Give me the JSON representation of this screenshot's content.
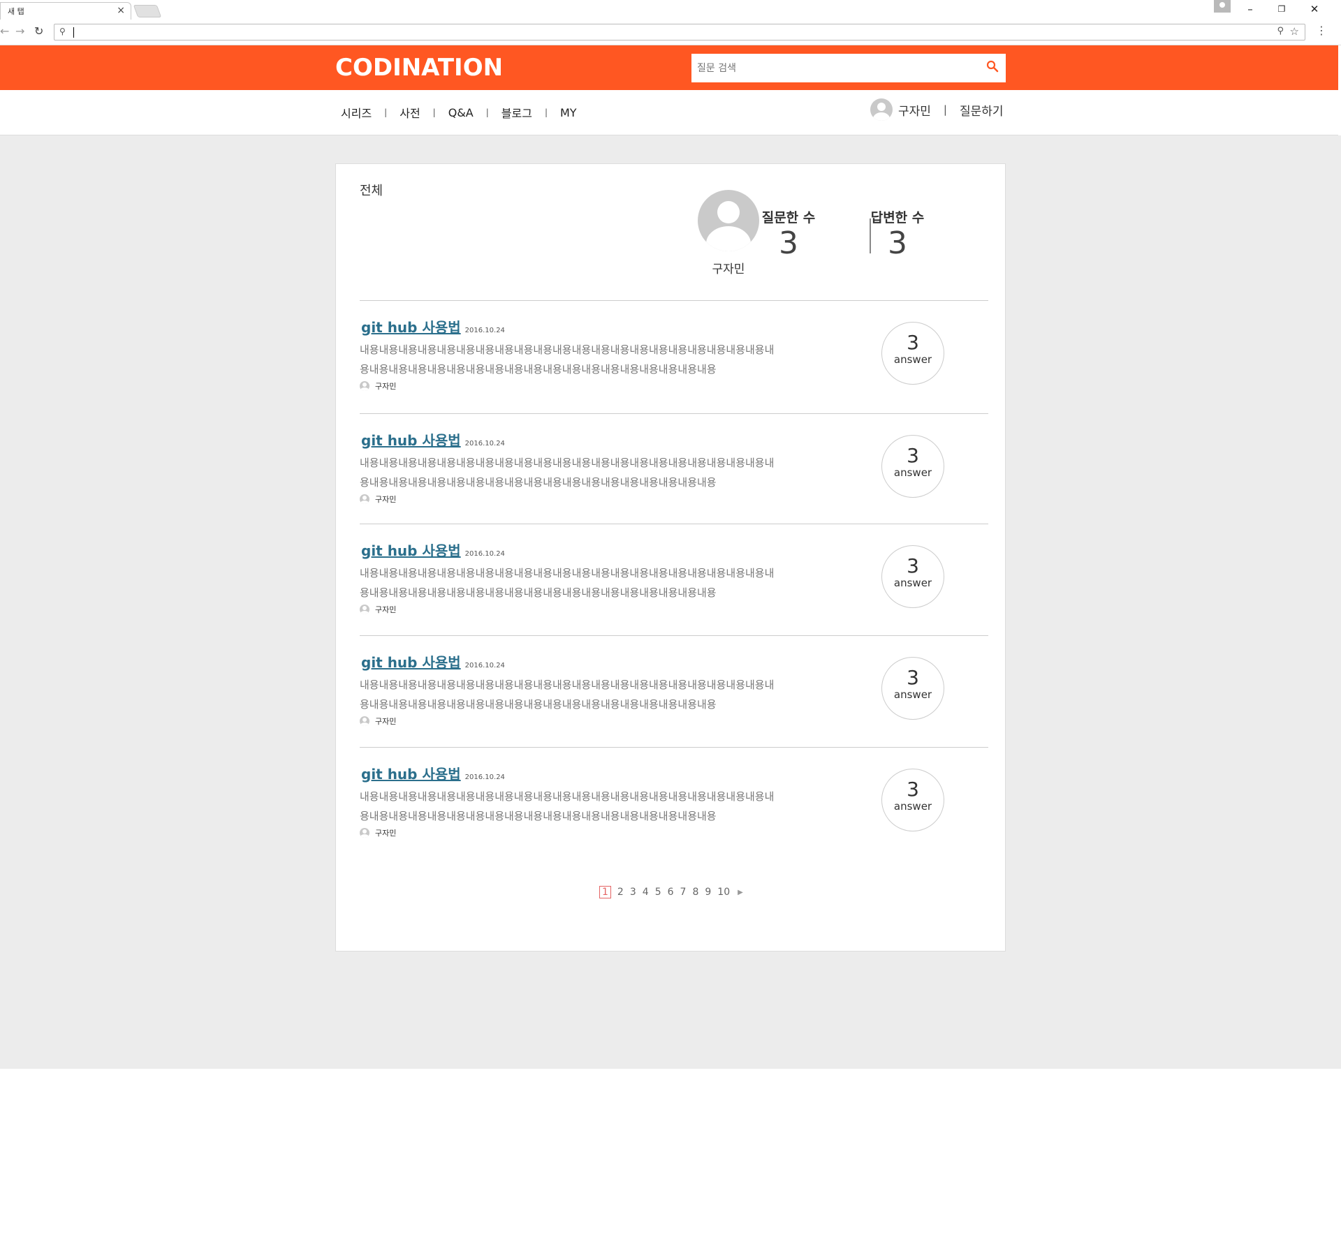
{
  "browser": {
    "tab_title": "새 탭",
    "tab_close": "×",
    "address_value": ""
  },
  "site": {
    "logo": "CODINATION",
    "search_placeholder": "질문 검색",
    "brand_color": "#ff5722",
    "menu": [
      "시리즈",
      "사전",
      "Q&A",
      "블로그",
      "MY"
    ],
    "menu_separator": "|",
    "user_name": "구자민",
    "ask_label": "질문하기"
  },
  "profile": {
    "section_title": "전체",
    "name": "구자민",
    "asked_label": "질문한 수",
    "asked_count": "3",
    "answered_label": "답변한 수",
    "answered_count": "3"
  },
  "questions": [
    {
      "title": "git hub 사용법",
      "date": "2016.10.24",
      "content": "내용내용내용내용내용내용내용내용내용내용내용내용내용내용내용내용내용내용내용내용내용내용내용내용내용내용내용내용내용내용내용내용내용내용내용내용내용내용내용내용",
      "author": "구자민",
      "answer_count": "3",
      "answer_label": "answer"
    },
    {
      "title": "git hub 사용법",
      "date": "2016.10.24",
      "content": "내용내용내용내용내용내용내용내용내용내용내용내용내용내용내용내용내용내용내용내용내용내용내용내용내용내용내용내용내용내용내용내용내용내용내용내용내용내용내용내용",
      "author": "구자민",
      "answer_count": "3",
      "answer_label": "answer"
    },
    {
      "title": "git hub 사용법",
      "date": "2016.10.24",
      "content": "내용내용내용내용내용내용내용내용내용내용내용내용내용내용내용내용내용내용내용내용내용내용내용내용내용내용내용내용내용내용내용내용내용내용내용내용내용내용내용내용",
      "author": "구자민",
      "answer_count": "3",
      "answer_label": "answer"
    },
    {
      "title": "git hub 사용법",
      "date": "2016.10.24",
      "content": "내용내용내용내용내용내용내용내용내용내용내용내용내용내용내용내용내용내용내용내용내용내용내용내용내용내용내용내용내용내용내용내용내용내용내용내용내용내용내용내용",
      "author": "구자민",
      "answer_count": "3",
      "answer_label": "answer"
    },
    {
      "title": "git hub 사용법",
      "date": "2016.10.24",
      "content": "내용내용내용내용내용내용내용내용내용내용내용내용내용내용내용내용내용내용내용내용내용내용내용내용내용내용내용내용내용내용내용내용내용내용내용내용내용내용내용내용",
      "author": "구자민",
      "answer_count": "3",
      "answer_label": "answer"
    }
  ],
  "pagination": {
    "pages": [
      "1",
      "2",
      "3",
      "4",
      "5",
      "6",
      "7",
      "8",
      "9",
      "10"
    ],
    "current": "1",
    "next_icon": "next-arrow-icon"
  }
}
